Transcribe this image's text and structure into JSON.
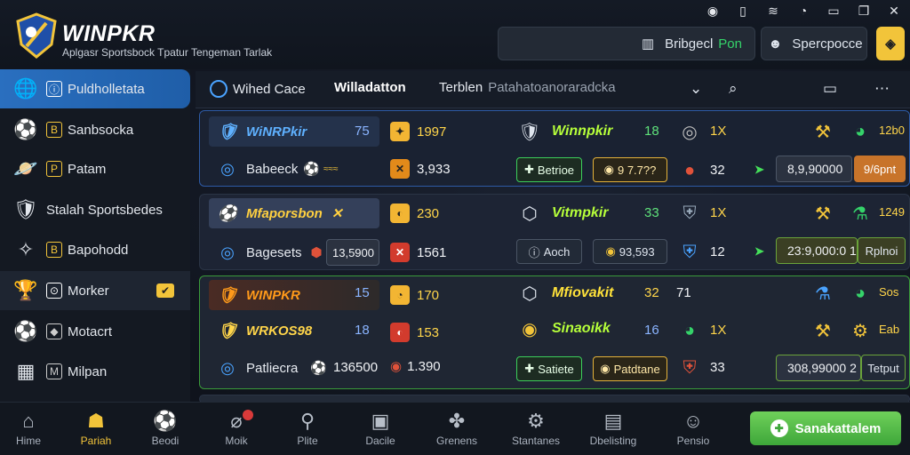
{
  "system_bar": [
    "record-icon",
    "sim-icon",
    "wifi-icon",
    "signal-icon",
    "minimize-icon",
    "maximize-icon",
    "close-icon"
  ],
  "header": {
    "brand": "WINPKR",
    "tagline": "Aplgasr Sportsbock Tpatur Tengeman Tarlak",
    "account_label": "Bribgecl",
    "account_value": "Pon",
    "sport_label": "Spercpocce"
  },
  "sidebar": {
    "items": [
      {
        "label": "Puldholletata",
        "icon": "globe-icon"
      },
      {
        "label": "Sanbsocka",
        "icon": "soccer-ball-icon"
      },
      {
        "label": "Patam",
        "icon": "planet-icon"
      },
      {
        "label": "Stalah Sportsbedes",
        "icon": "crest-icon"
      },
      {
        "label": "Bapohodd",
        "icon": "shield-icon"
      },
      {
        "label": "Morker",
        "icon": "trophy-icon"
      },
      {
        "label": "Motacrt",
        "icon": "soccer-ball-icon"
      },
      {
        "label": "Milpan",
        "icon": "cube-icon"
      }
    ]
  },
  "tabs": {
    "first": "Wihed Cace",
    "second": "Willadatton",
    "third": "Terblen",
    "third_extra": "Patahatoanoraradcka"
  },
  "rows": [
    {
      "team": "WiNRPkir",
      "team_num": "75",
      "badge_value": "1997",
      "sub_team": "Babeeck",
      "sub_score": "3,933",
      "mid_team": "Winnpkir",
      "mid_num": "18",
      "mid_x": "1X",
      "pill1": "Betrioe",
      "pill2": "9 7.7??",
      "mid_odd": "32",
      "right_value": "8,9,90000",
      "right_pill": "9/6pnt",
      "right_small": "12b0"
    },
    {
      "team": "Mfaporsbon",
      "badge_value": "230",
      "sub_team": "Bagesets",
      "sub_score": "13,5900",
      "sub_score2": "1561",
      "mid_team": "Vitmpkir",
      "mid_num": "33",
      "mid_x": "1X",
      "pill1": "Aoch",
      "pill2": "93,593",
      "mid_odd": "12",
      "right_value": "23:9,000:0 1",
      "right_pill": "Rplnoi",
      "right_small": "1249"
    },
    {
      "team": "WINPKR",
      "team_num": "15",
      "badge_value": "170",
      "team2": "WRKOS98",
      "team2_num": "18",
      "badge2_value": "153",
      "sub_team": "Patliecra",
      "sub_score": "136500",
      "sub_score2": "1.390",
      "mid_team": "Mfiovakit",
      "mid_num": "32",
      "mid_x": "71",
      "mid_team2": "Sinaoikk",
      "mid_num2": "16",
      "mid_x2": "1X",
      "pill1": "Satiete",
      "pill2": "Patdtane",
      "mid_odd": "33",
      "right_value": "308,99000 2",
      "right_pill": "Tetput",
      "right_small": "Sos",
      "right_small2": "Eab"
    }
  ],
  "bottom_nav": [
    {
      "label": "Hime",
      "icon": "home-icon"
    },
    {
      "label": "Pariah",
      "icon": "users-icon"
    },
    {
      "label": "Beodi",
      "icon": "soccer-icon"
    },
    {
      "label": "Moik",
      "icon": "racket-icon"
    },
    {
      "label": "Plite",
      "icon": "search-gear-icon"
    },
    {
      "label": "Dacile",
      "icon": "box-icon"
    },
    {
      "label": "Grenens",
      "icon": "puzzle-icon"
    },
    {
      "label": "Stantanes",
      "icon": "gear-icon"
    },
    {
      "label": "Dbelisting",
      "icon": "film-icon"
    },
    {
      "label": "Pensio",
      "icon": "person-icon"
    }
  ],
  "cta_label": "Sanakattalem"
}
